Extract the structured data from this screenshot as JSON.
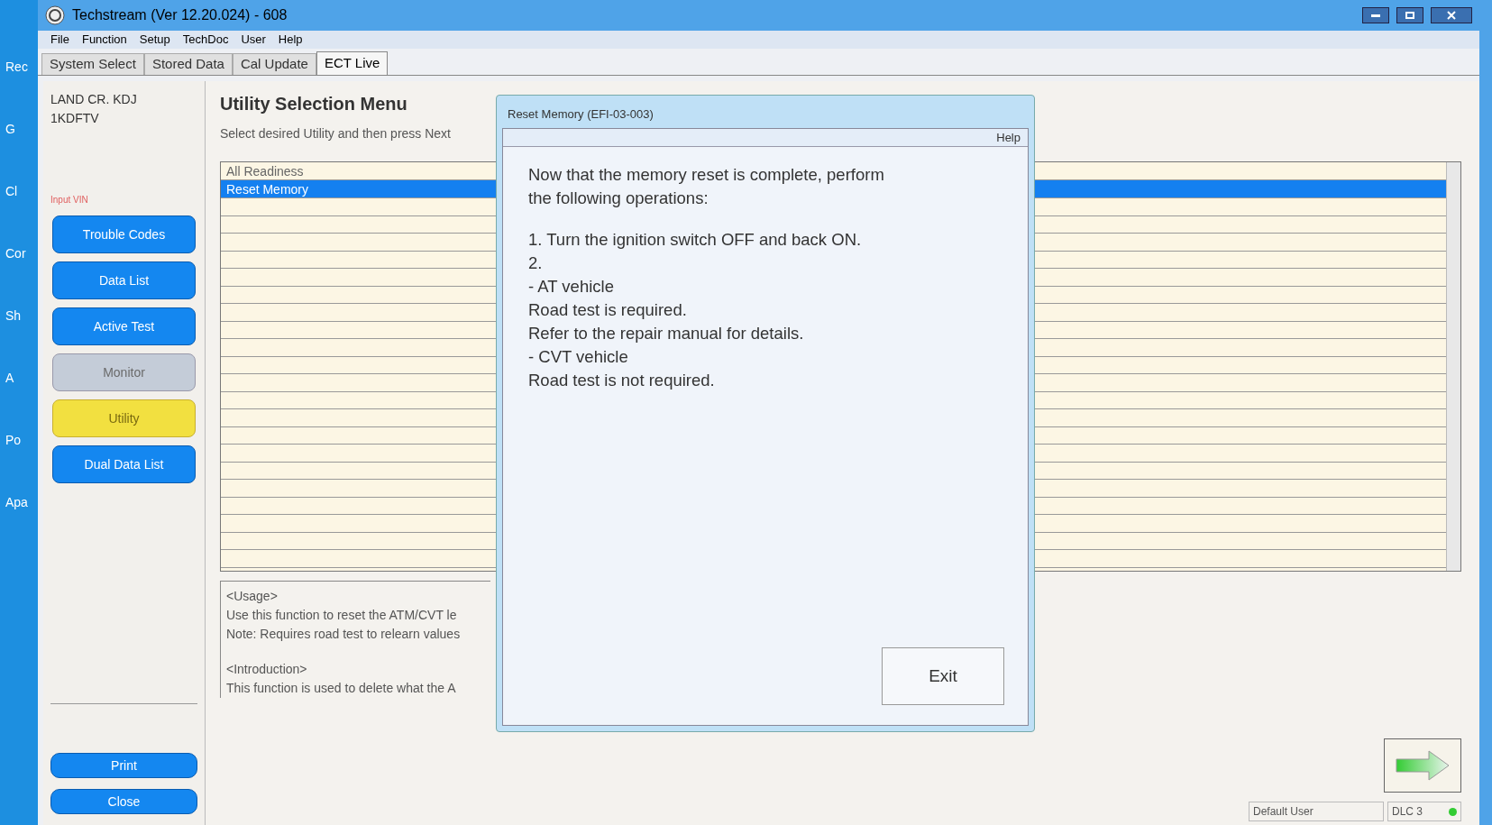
{
  "desktop_icons": [
    {
      "label": "Rec"
    },
    {
      "label": "G"
    },
    {
      "label": "Cl"
    },
    {
      "label": "Cor"
    },
    {
      "label": "Sh"
    },
    {
      "label": "A"
    },
    {
      "label": "Po"
    },
    {
      "label": "Apa"
    }
  ],
  "window": {
    "title": "Techstream (Ver 12.20.024) - 608"
  },
  "menu": [
    "File",
    "Function",
    "Setup",
    "TechDoc",
    "User",
    "Help"
  ],
  "tabs": [
    {
      "label": "System Select",
      "selected": false
    },
    {
      "label": "Stored Data",
      "selected": false
    },
    {
      "label": "Cal Update",
      "selected": false
    },
    {
      "label": "ECT Live",
      "selected": true
    }
  ],
  "sidebar": {
    "vehicle": [
      "LAND CR. KDJ",
      "1KDFTV"
    ],
    "input_vin": "Input VIN",
    "buttons": [
      {
        "label": "Trouble Codes",
        "selected": false,
        "disabled": false
      },
      {
        "label": "Data List",
        "selected": false,
        "disabled": false
      },
      {
        "label": "Active Test",
        "selected": false,
        "disabled": false
      },
      {
        "label": "Monitor",
        "selected": false,
        "disabled": true
      },
      {
        "label": "Utility",
        "selected": true,
        "disabled": false
      },
      {
        "label": "Dual Data List",
        "selected": false,
        "disabled": false
      }
    ],
    "bottom_buttons": [
      "Print",
      "Close"
    ]
  },
  "content": {
    "title": "Utility Selection Menu",
    "instruction": "Select desired Utility and then press Next",
    "utilities": [
      {
        "label": "All Readiness",
        "selected": false
      },
      {
        "label": "Reset Memory",
        "selected": true
      }
    ],
    "description": [
      "<Usage>",
      "Use this function to reset the ATM/CVT le",
      "Note: Requires road test to relearn values",
      "<Introduction>",
      "This function is used to delete what the A"
    ]
  },
  "dialog": {
    "title": "Reset Memory (EFI-03-003)",
    "help": "Help",
    "message": [
      "Now that the memory reset is complete, perform",
      "the following operations:"
    ],
    "steps": [
      "1. Turn the ignition switch OFF and back ON.",
      "2.",
      "- AT vehicle",
      "Road test is required.",
      "Refer to the repair manual for details.",
      "- CVT vehicle",
      "Road test is not required."
    ],
    "button": "Exit"
  },
  "status_bar": {
    "user": "Default User",
    "connection": "DLC 3",
    "color": "#33cc33"
  }
}
